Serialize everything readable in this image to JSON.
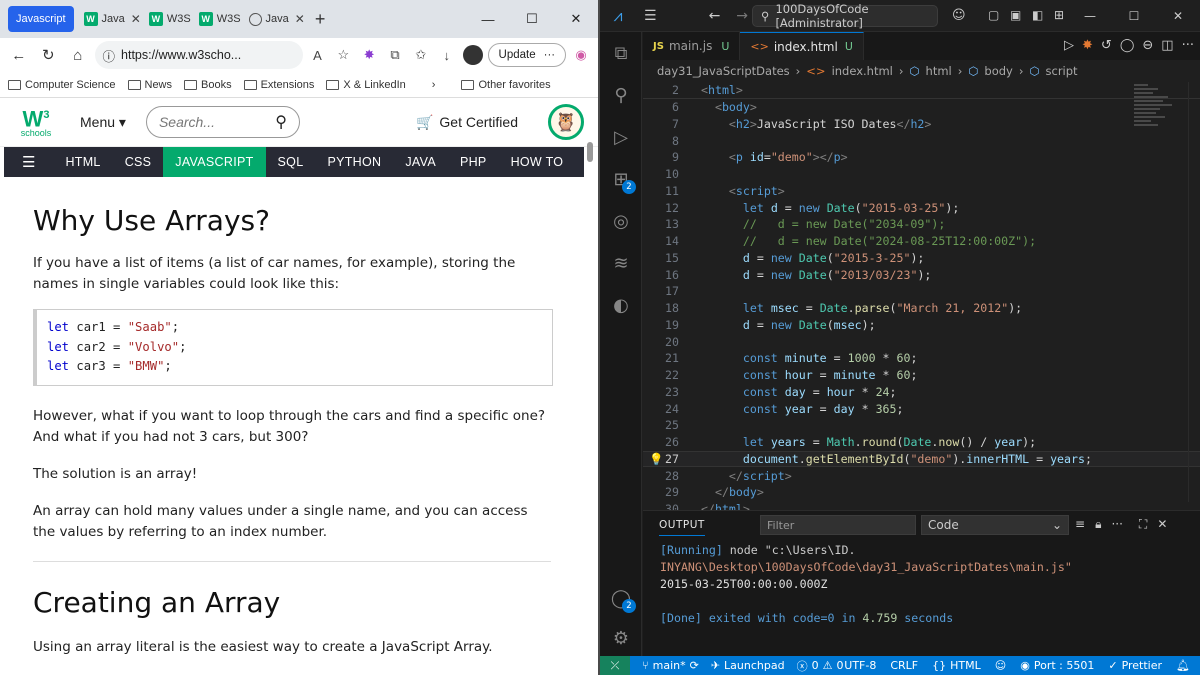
{
  "browser": {
    "tabs": [
      {
        "label": "Javascript",
        "active": true
      },
      {
        "label": "Java",
        "icon": "w3"
      },
      {
        "label": "W3S",
        "icon": "w3"
      },
      {
        "label": "W3S",
        "icon": "w3"
      },
      {
        "label": "Java",
        "icon": "globe"
      }
    ],
    "url": "https://www.w3scho...",
    "update_label": "Update",
    "favorites": [
      "Computer Science",
      "News",
      "Books",
      "Extensions",
      "X & LinkedIn"
    ],
    "other_favorites": "Other favorites"
  },
  "w3": {
    "logo_main": "W",
    "logo_sup": "3",
    "logo_sub": "schools",
    "menu_label": "Menu",
    "search_placeholder": "Search...",
    "get_certified": "Get Certified",
    "nav": [
      "HTML",
      "CSS",
      "JAVASCRIPT",
      "SQL",
      "PYTHON",
      "JAVA",
      "PHP",
      "HOW TO"
    ],
    "nav_active": "JAVASCRIPT",
    "heading1": "Why Use Arrays?",
    "p1": "If you have a list of items (a list of car names, for example), storing the names in single variables could look like this:",
    "code_lines": [
      {
        "kw": "let",
        "rest": " car1 = ",
        "str": "\"Saab\"",
        "end": ";"
      },
      {
        "kw": "let",
        "rest": " car2 = ",
        "str": "\"Volvo\"",
        "end": ";"
      },
      {
        "kw": "let",
        "rest": " car3 = ",
        "str": "\"BMW\"",
        "end": ";"
      }
    ],
    "p2": "However, what if you want to loop through the cars and find a specific one? And what if you had not 3 cars, but 300?",
    "p3": "The solution is an array!",
    "p4": "An array can hold many values under a single name, and you can access the values by referring to an index number.",
    "heading2": "Creating an Array",
    "p5": "Using an array literal is the easiest way to create a JavaScript Array."
  },
  "vscode": {
    "command_center": "100DaysOfCode [Administrator]",
    "tabs": [
      {
        "label": "main.js",
        "status": "U",
        "active": false
      },
      {
        "label": "index.html",
        "status": "U",
        "active": true
      }
    ],
    "breadcrumb": [
      "day31_JavaScriptDates",
      "index.html",
      "html",
      "body",
      "script"
    ],
    "activity_badges": {
      "extensions": "2",
      "accounts": "2"
    },
    "output_title": "OUTPUT",
    "filter_placeholder": "Filter",
    "output_channel": "Code",
    "output_lines": {
      "running_tag": "[Running]",
      "running_cmd": " node \"c:\\Users\\ID.",
      "running_path": "INYANG\\Desktop\\100DaysOfCode\\day31_JavaScriptDates\\main.js\"",
      "result": "2015-03-25T00:00:00.000Z",
      "done_text": "[Done] exited with code=0 in ",
      "done_time": "4.759",
      "done_unit": " seconds"
    },
    "status": {
      "branch": "main*",
      "launchpad": "Launchpad",
      "errors": "0",
      "warnings": "0",
      "encoding": "UTF-8",
      "eol": "CRLF",
      "language": "HTML",
      "port": "Port : 5501",
      "prettier": "Prettier"
    }
  }
}
